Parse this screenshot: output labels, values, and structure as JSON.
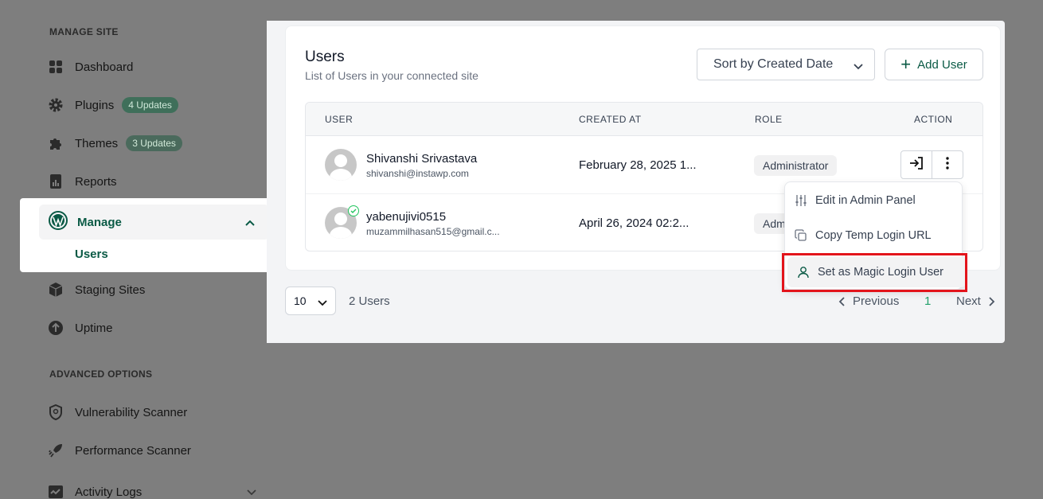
{
  "sidebar": {
    "manage_site_label": "MANAGE SITE",
    "items": [
      {
        "label": "Dashboard",
        "icon": "dashboard-icon"
      },
      {
        "label": "Plugins",
        "icon": "gear-icon",
        "badge": "4 Updates"
      },
      {
        "label": "Themes",
        "icon": "puzzle-icon",
        "badge": "3 Updates"
      },
      {
        "label": "Reports",
        "icon": "report-icon"
      }
    ],
    "manage": {
      "label": "Manage",
      "icon": "wordpress-icon",
      "sub_item": "Users"
    },
    "items_after": [
      {
        "label": "Staging Sites",
        "icon": "box-icon"
      },
      {
        "label": "Uptime",
        "icon": "arrow-up-circle-icon"
      }
    ],
    "advanced_label": "ADVANCED OPTIONS",
    "advanced_items": [
      {
        "label": "Vulnerability Scanner",
        "icon": "shield-icon"
      },
      {
        "label": "Performance Scanner",
        "icon": "rocket-icon"
      },
      {
        "label": "Activity Logs",
        "icon": "activity-icon"
      }
    ]
  },
  "users_card": {
    "title": "Users",
    "subtitle": "List of Users in your connected site",
    "sort_label": "Sort by Created Date",
    "add_user_label": "Add User"
  },
  "table": {
    "headers": [
      "USER",
      "CREATED AT",
      "ROLE",
      "ACTION"
    ],
    "rows": [
      {
        "name": "Shivanshi Srivastava",
        "email": "shivanshi@instawp.com",
        "created": "February 28, 2025 1...",
        "role": "Administrator"
      },
      {
        "name": "yabenujivi0515",
        "email": "muzammilhasan515@gmail.c...",
        "created": "April 26, 2024 02:2...",
        "role": "Adm"
      }
    ]
  },
  "pagination": {
    "per_page": "10",
    "count": "2 Users",
    "previous": "Previous",
    "page": "1",
    "next": "Next"
  },
  "menu": {
    "items": [
      "Edit in Admin Panel",
      "Copy Temp Login URL",
      "Set as Magic Login User"
    ]
  },
  "colors": {
    "accent": "#0a5a45",
    "highlight": "#e3141b"
  }
}
